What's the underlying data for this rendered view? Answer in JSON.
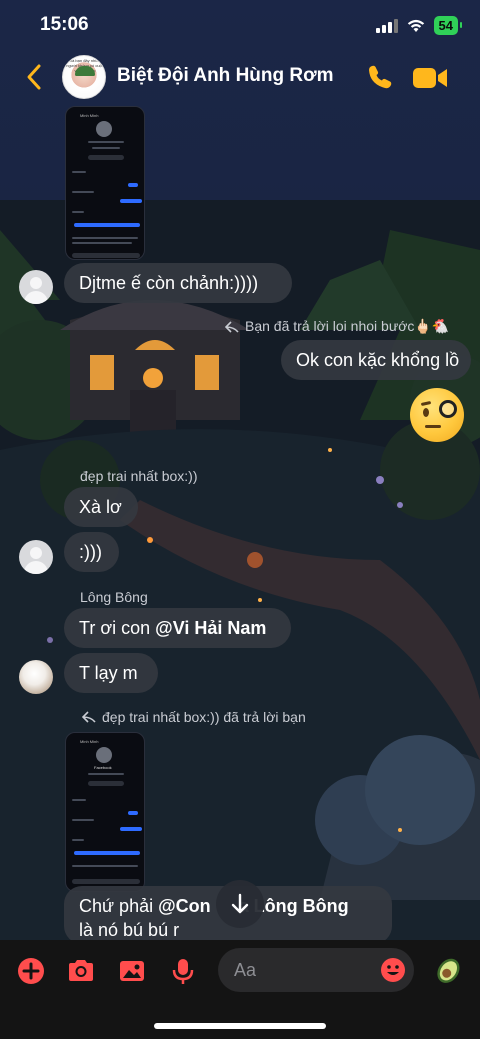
{
  "status": {
    "time": "15:06",
    "battery": "54"
  },
  "header": {
    "title": "Biệt Đội Anh Hùng Rơm",
    "avatar_caption": "nhà bạn đây những người\nkhông có cuộc\nvà nghĩ vực"
  },
  "thumb": {
    "name": "Minh Minh",
    "subtitle": "Facebook"
  },
  "messages": {
    "m1": "Djtme ế còn chảnh:))))",
    "reply1": "Bạn đã trả lời loi nhoi bước🖕🏻🐔",
    "m2": "Ok con kặc khổng lồ",
    "sender1": "đẹp trai nhất box:))",
    "m3": "Xà lơ",
    "m4": ":)))",
    "sender2": "Lông Bông",
    "m5_prefix": "Tr ơi con ",
    "m5_mention": "@Vi Hải Nam",
    "m6": "T lạy m",
    "reply2": "đẹp trai nhất box:)) đã trả lời bạn",
    "m7_prefix": "Chứ phải ",
    "m7_mention": "@Con",
    "m7_hidden": "a Lông Bông",
    "m7_line2": "là nó bú bú r"
  },
  "composer": {
    "placeholder": "Aa"
  },
  "colors": {
    "accent": "#ffb71c",
    "composer_icons": "#ff4d4d",
    "bubble": "#343840",
    "battery": "#30d158"
  }
}
